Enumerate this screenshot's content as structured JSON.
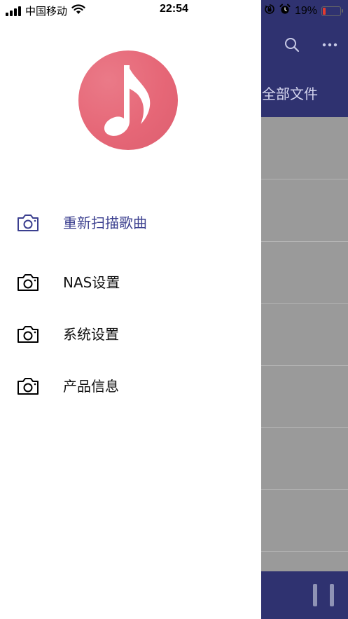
{
  "status_bar": {
    "carrier": "中国移动",
    "time": "22:54",
    "battery_percent": "19%",
    "battery_level": 0.19
  },
  "background": {
    "tab_label": "全部文件"
  },
  "menu": {
    "items": [
      {
        "label": "重新扫描歌曲",
        "icon": "camera-icon",
        "active": true
      },
      {
        "label": "NAS设置",
        "icon": "camera-icon",
        "active": false
      },
      {
        "label": "系统设置",
        "icon": "camera-icon",
        "active": false
      },
      {
        "label": "产品信息",
        "icon": "camera-icon",
        "active": false
      }
    ]
  },
  "colors": {
    "accent": "#3b3f8f",
    "header": "#2f3270",
    "avatar": "#e66777",
    "battery_low": "#e33b2f"
  }
}
